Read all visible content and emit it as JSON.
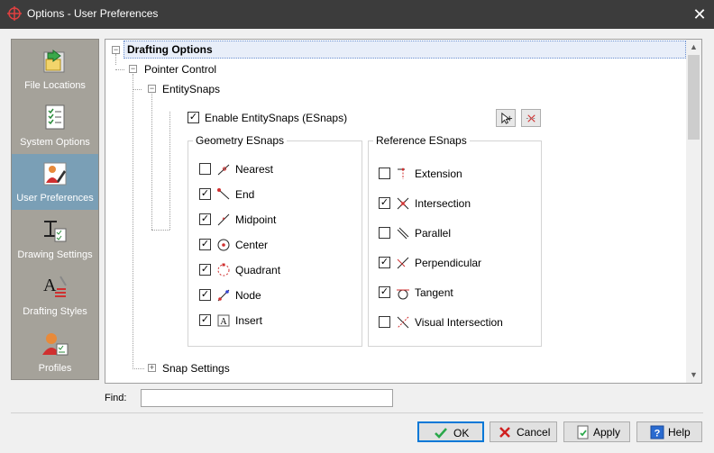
{
  "window": {
    "title": "Options - User Preferences",
    "close_label": "✕"
  },
  "sidebar": {
    "items": [
      {
        "label": "File Locations",
        "icon": "folder-arrow-icon",
        "selected": false
      },
      {
        "label": "System Options",
        "icon": "checklist-icon",
        "selected": false
      },
      {
        "label": "User Preferences",
        "icon": "user-pencil-icon",
        "selected": true
      },
      {
        "label": "Drawing Settings",
        "icon": "drawing-settings-icon",
        "selected": false
      },
      {
        "label": "Drafting Styles",
        "icon": "text-style-icon",
        "selected": false
      },
      {
        "label": "Profiles",
        "icon": "user-profile-icon",
        "selected": false
      }
    ]
  },
  "tree": {
    "root": "Drafting Options",
    "pointer_control": "Pointer Control",
    "entity_snaps": "EntitySnaps",
    "enable_esnaps": {
      "label": "Enable EntitySnaps (ESnaps)",
      "checked": true
    },
    "geometry": {
      "title": "Geometry ESnaps",
      "items": [
        {
          "label": "Nearest",
          "checked": false,
          "icon": "nearest-snap-icon"
        },
        {
          "label": "End",
          "checked": true,
          "icon": "end-snap-icon"
        },
        {
          "label": "Midpoint",
          "checked": true,
          "icon": "midpoint-snap-icon"
        },
        {
          "label": "Center",
          "checked": true,
          "icon": "center-snap-icon"
        },
        {
          "label": "Quadrant",
          "checked": true,
          "icon": "quadrant-snap-icon"
        },
        {
          "label": "Node",
          "checked": true,
          "icon": "node-snap-icon"
        },
        {
          "label": "Insert",
          "checked": true,
          "icon": "insert-snap-icon"
        }
      ]
    },
    "reference": {
      "title": "Reference ESnaps",
      "items": [
        {
          "label": "Extension",
          "checked": false,
          "icon": "extension-snap-icon"
        },
        {
          "label": "Intersection",
          "checked": true,
          "icon": "intersection-snap-icon"
        },
        {
          "label": "Parallel",
          "checked": false,
          "icon": "parallel-snap-icon"
        },
        {
          "label": "Perpendicular",
          "checked": true,
          "icon": "perpendicular-snap-icon"
        },
        {
          "label": "Tangent",
          "checked": true,
          "icon": "tangent-snap-icon"
        },
        {
          "label": "Visual Intersection",
          "checked": false,
          "icon": "visual-intersection-snap-icon"
        }
      ]
    },
    "snap_settings": "Snap Settings"
  },
  "find": {
    "label": "Find:",
    "value": ""
  },
  "buttons": {
    "ok": "OK",
    "cancel": "Cancel",
    "apply": "Apply",
    "help": "Help"
  },
  "colors": {
    "titlebar": "#3c3c3c",
    "sidebar": "#a5a29a",
    "sidebar_selected": "#7a9fb6",
    "accent": "#0078d7"
  }
}
